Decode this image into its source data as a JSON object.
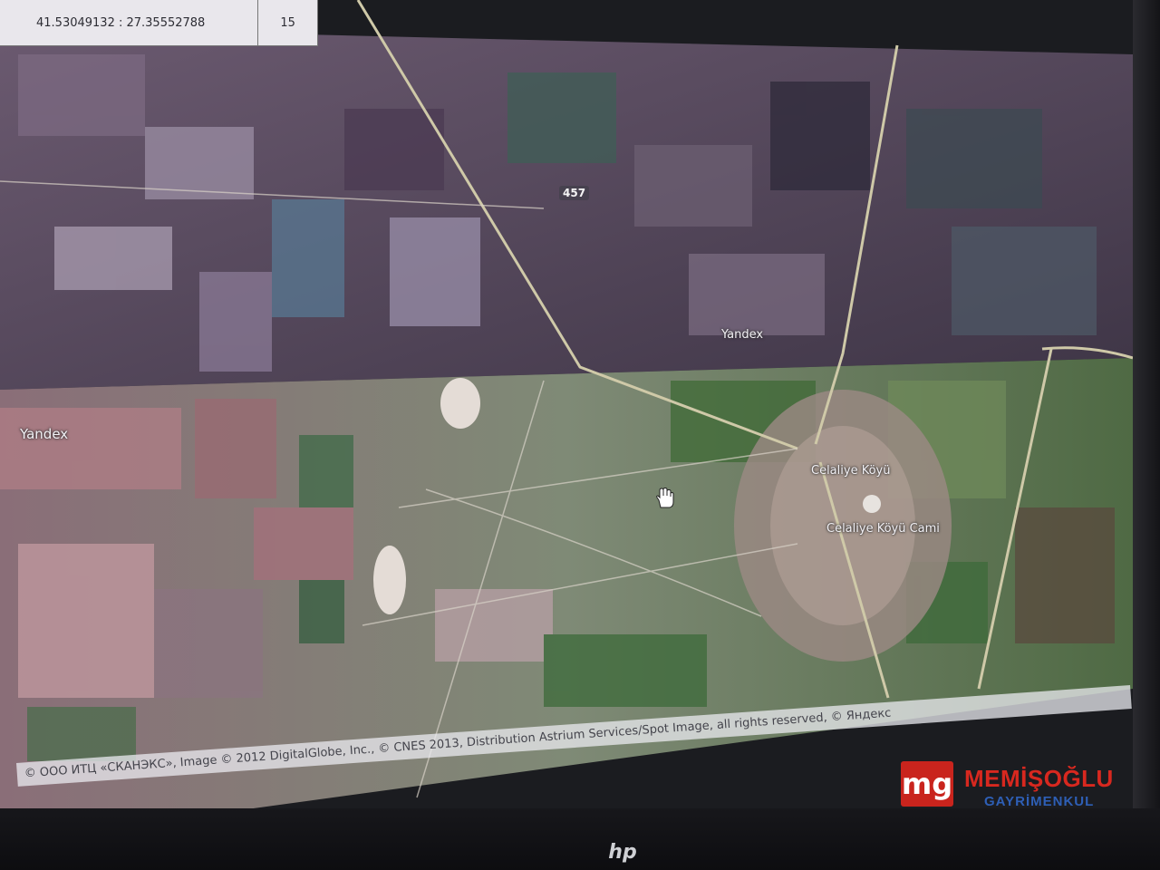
{
  "coordinates": "41.53049132 : 27.35552788",
  "zoom_level": "15",
  "map": {
    "road_label": "457",
    "watermarks": [
      "Yandex",
      "Yandex"
    ],
    "places": [
      "Celaliye Köyü",
      "Celaliye Köyü Cami"
    ]
  },
  "attribution": "© ООО ИТЦ «СКАНЭКС», Image © 2012 DigitalGlobe, Inc., © CNES 2013, Distribution Astrium Services/Spot Image, all rights reserved, © Яндекс",
  "device_brand": "hp",
  "brand": {
    "logo_text": "mg",
    "name": "MEMİŞOĞLU",
    "subtitle": "GAYRİMENKUL"
  },
  "colors": {
    "brand_red": "#d8281f",
    "brand_blue": "#2e5fb6",
    "field_purple": "#5a4660",
    "field_green": "#4e6a3a",
    "road": "#cfc9a8"
  },
  "icons": [
    "hand-cursor-icon"
  ]
}
